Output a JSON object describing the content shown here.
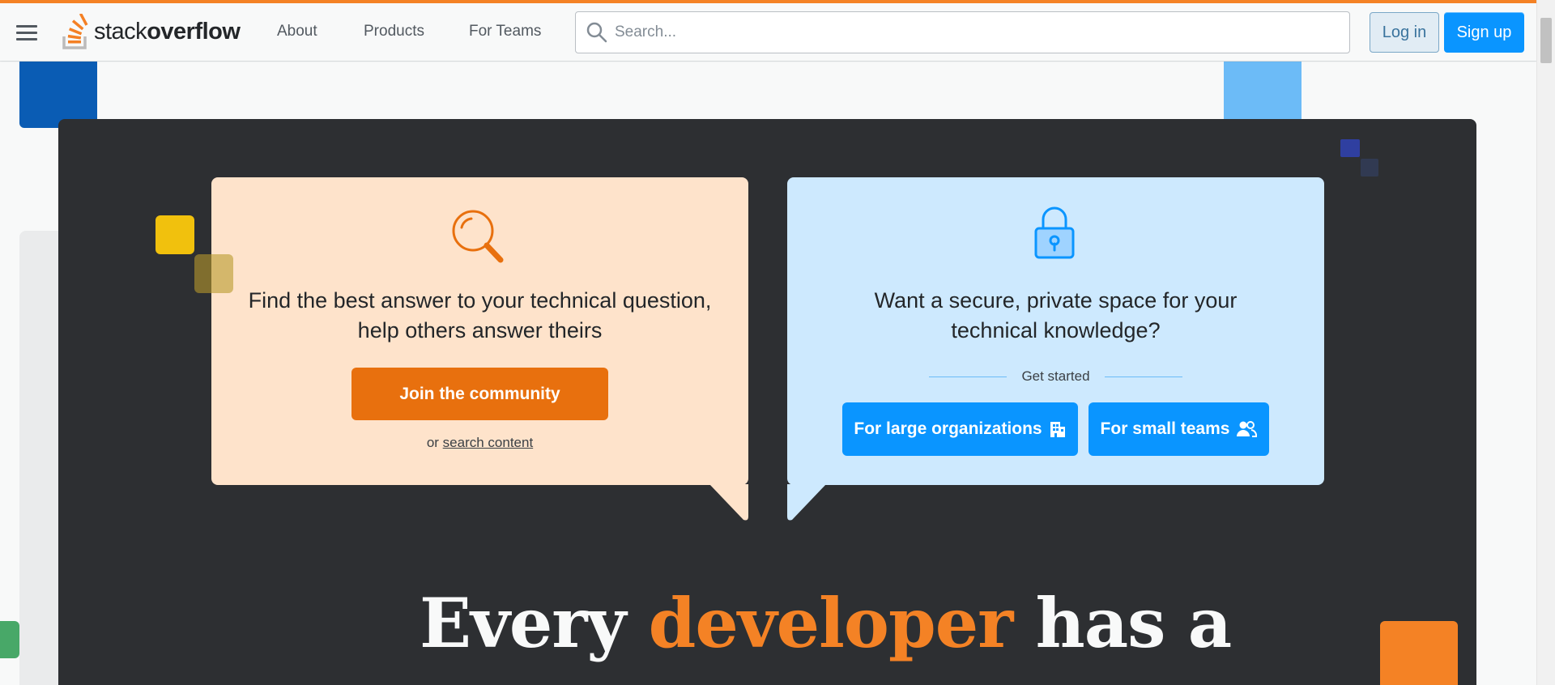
{
  "header": {
    "logo_regular": "stack",
    "logo_bold": "overflow",
    "nav": [
      "About",
      "Products",
      "For Teams"
    ],
    "search_placeholder": "Search...",
    "login_label": "Log in",
    "signup_label": "Sign up"
  },
  "cards": {
    "community": {
      "title": "Find the best answer to your technical question, help others answer theirs",
      "join_label": "Join the community",
      "or_text": "or",
      "search_link": "search content"
    },
    "teams": {
      "title": "Want a secure, private space for your technical knowledge?",
      "get_started": "Get started",
      "large_org_label": "For large organizations",
      "small_teams_label": "For small teams"
    }
  },
  "hero": {
    "headline_part1": "Every",
    "headline_accent": "developer",
    "headline_part2": "has a"
  },
  "colors": {
    "brand_orange": "#f48225",
    "button_orange": "#e8700e",
    "button_blue": "#0a95ff",
    "hero_dark": "#2d2f32"
  }
}
